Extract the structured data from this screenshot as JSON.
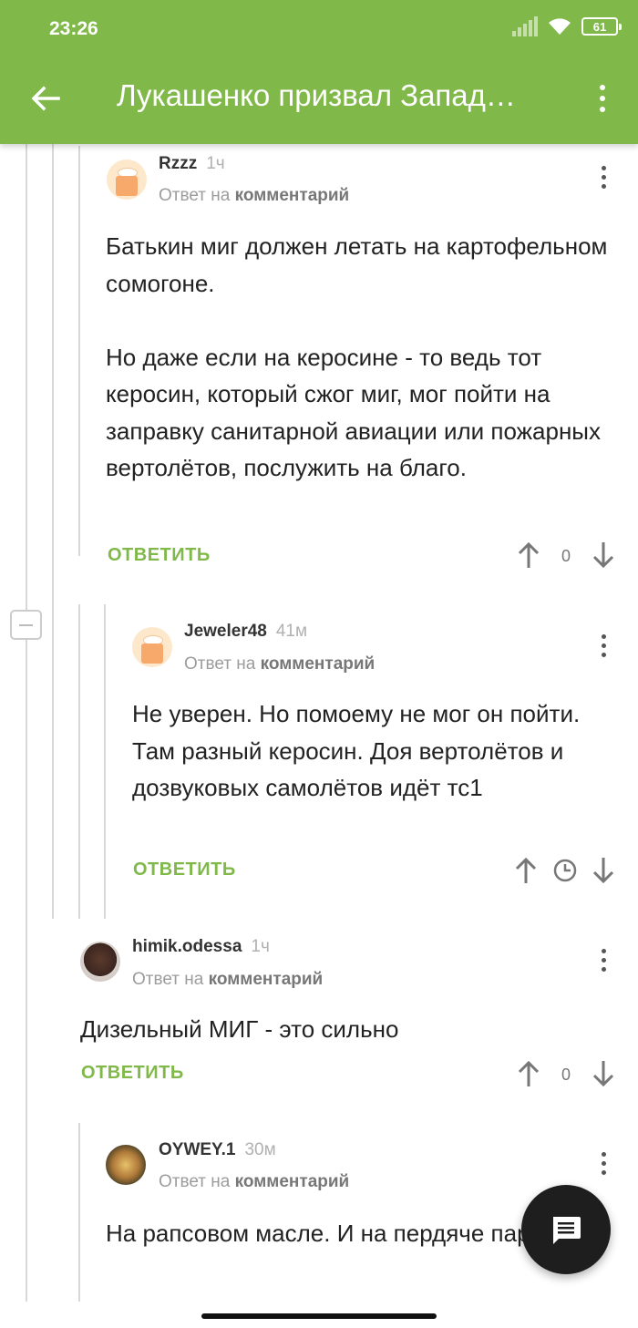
{
  "status_bar": {
    "time": "23:26",
    "battery": "61"
  },
  "header": {
    "title": "Лукашенко призвал Запад…"
  },
  "colors": {
    "brand": "#80b94a",
    "reply_action": "#80b94a",
    "fab": "#1e1e1e"
  },
  "comments": [
    {
      "author": "Rzzz",
      "time": "1ч",
      "reply_prefix": "Ответ на",
      "reply_target": "комментарий",
      "body": "Батькин миг должен летать на картофельном сомогоне.\n\nНо даже если на керосине - то ведь тот керосин, который сжог миг, мог пойти на заправку санитарной авиации или пожарных вертолётов, послужить на благо.",
      "reply_label": "ОТВЕТИТЬ",
      "score": "0",
      "avatar": "default-avatar"
    },
    {
      "author": "Jeweler48",
      "time": "41м",
      "reply_prefix": "Ответ на",
      "reply_target": "комментарий",
      "body": "Не уверен. Но помоему не мог он пойти. Там разный керосин. Доя вертолётов и дозвуковых самолётов идёт тс1",
      "reply_label": "ОТВЕТИТЬ",
      "avatar": "default-avatar",
      "score_icon": "clock-icon"
    },
    {
      "author": "himik.odessa",
      "time": "1ч",
      "reply_prefix": "Ответ на",
      "reply_target": "комментарий",
      "body": "Дизельный МИГ - это сильно",
      "reply_label": "ОТВЕТИТЬ",
      "score": "0",
      "avatar": "photo-avatar"
    },
    {
      "author": "OYWEY.1",
      "time": "30м",
      "reply_prefix": "Ответ на",
      "reply_target": "комментарий",
      "body": "На рапсовом масле. И на пердяче паре.",
      "avatar": "photo-avatar"
    }
  ],
  "fab": {
    "icon": "comment-icon"
  }
}
